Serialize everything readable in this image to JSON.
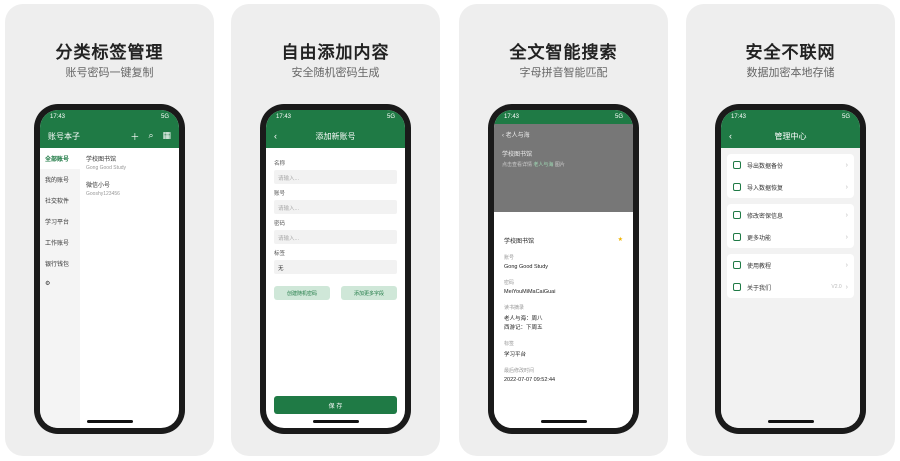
{
  "colors": {
    "brand": "#1f7a45",
    "panel_bg": "#eeeeee",
    "star": "#f0b400"
  },
  "status": {
    "time": "17:43",
    "signal": "5G"
  },
  "panels": [
    {
      "title": "分类标签管理",
      "subtitle": "账号密码一键复制"
    },
    {
      "title": "自由添加内容",
      "subtitle": "安全随机密码生成"
    },
    {
      "title": "全文智能搜索",
      "subtitle": "字母拼音智能匹配"
    },
    {
      "title": "安全不联网",
      "subtitle": "数据加密本地存储"
    }
  ],
  "screen1": {
    "title": "账号本子",
    "icons": [
      "add-icon",
      "search-icon",
      "grid-icon"
    ],
    "categories": [
      "全部账号",
      "我的账号",
      "社交软件",
      "学习平台",
      "工作账号",
      "银行钱包",
      "⚙"
    ],
    "items": [
      {
        "title": "学校图书馆",
        "sub": "Gong Good Study"
      },
      {
        "title": "微信小号",
        "sub": "Gooshy123456"
      }
    ]
  },
  "screen2": {
    "title": "添加新账号",
    "fields": [
      {
        "label": "名称",
        "value": "请输入..."
      },
      {
        "label": "账号",
        "value": "请输入..."
      },
      {
        "label": "密码",
        "value": "请输入..."
      },
      {
        "label": "标签",
        "value": "无"
      }
    ],
    "btn_random": "创建随机密码",
    "btn_more": "添加更多字段",
    "save": "保 存"
  },
  "screen3": {
    "search": "老人与海",
    "result_title": "学校图书馆",
    "result_sub": "点击查看详情",
    "result_tags": [
      "老人与海",
      "图片"
    ],
    "sheet_title": "学校图书馆",
    "fields": [
      {
        "k": "账号",
        "v": "Gong Good Study"
      },
      {
        "k": "密码",
        "v": "MeiYouMiMaCaiGuai"
      },
      {
        "k": "读书摘录",
        "v1": "老人与海：周八",
        "v2": "西游记：下周五"
      },
      {
        "k": "标签",
        "v": "学习平台"
      },
      {
        "k": "最后修改时间",
        "v": "2022-07-07 09:52:44"
      }
    ]
  },
  "screen4": {
    "title": "管理中心",
    "groups": [
      [
        "导出数据备份",
        "导入数据恢复"
      ],
      [
        "修改密保信息",
        "更多功能"
      ],
      [
        "使用教程",
        "关于我们"
      ]
    ],
    "version": "V2.0"
  }
}
